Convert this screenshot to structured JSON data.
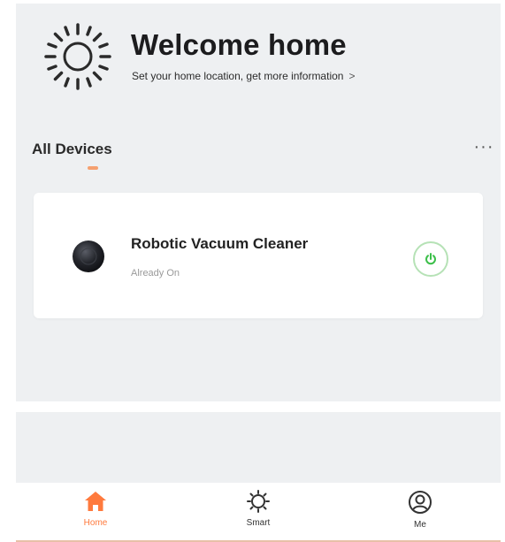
{
  "welcome": {
    "title": "Welcome home",
    "subtitle": "Set your home location, get more information",
    "chevron": ">",
    "icon": "sun-icon"
  },
  "devices": {
    "tab_label": "All Devices",
    "more_label": "···"
  },
  "device_card": {
    "name": "Robotic Vacuum Cleaner",
    "status": "Already On",
    "power_icon": "power-icon",
    "power_color": "#3cbf4a"
  },
  "tabbar": {
    "home_label": "Home",
    "smart_label": "Smart",
    "me_label": "Me",
    "active_color": "#ff7a3d"
  }
}
